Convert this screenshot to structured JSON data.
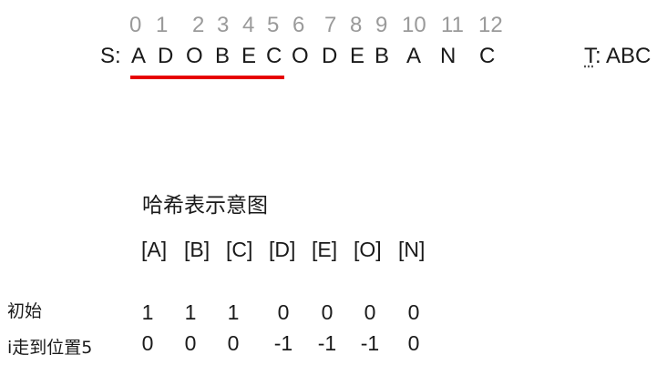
{
  "indices": [
    "0",
    "1",
    "2",
    "3",
    "4",
    "5",
    "6",
    "7",
    "8",
    "9",
    "10",
    "11",
    "12"
  ],
  "s_label": "S:",
  "s_chars": [
    "A",
    "D",
    "O",
    "B",
    "E",
    "C",
    "O",
    "D",
    "E",
    "B",
    "A",
    "N",
    "C"
  ],
  "t_label": {
    "letter": "T",
    "rest": ": ABC"
  },
  "window_color": "#e60000",
  "hash_title": "哈希表示意图",
  "hash_keys": [
    "[A]",
    "[B]",
    "[C]",
    "[D]",
    "[E]",
    "[O]",
    "[N]"
  ],
  "rows": [
    {
      "label": "初始",
      "values": [
        "1",
        "1",
        "1",
        "0",
        "0",
        "0",
        "0"
      ]
    },
    {
      "label": "i走到位置5",
      "values": [
        "0",
        "0",
        "0",
        "-1",
        "-1",
        "-1",
        "0"
      ]
    }
  ]
}
